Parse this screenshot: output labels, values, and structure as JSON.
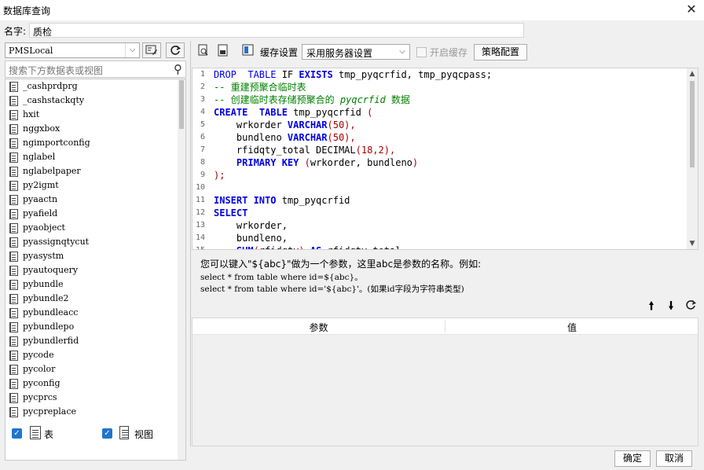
{
  "window": {
    "title": "数据库查询",
    "close_glyph": "✕"
  },
  "name_field": {
    "label": "名字:",
    "value": "质检"
  },
  "left_panel": {
    "datasource": "PMSLocal",
    "search_placeholder": "搜索下方数据表或视图",
    "items": [
      "_cashprdprg",
      "_cashstackqty",
      "hxit",
      "nggxbox",
      "ngimportconfig",
      "nglabel",
      "nglabelpaper",
      "py2igmt",
      "pyaactn",
      "pyafield",
      "pyaobject",
      "pyassignqtycut",
      "pyasystm",
      "pyautoquery",
      "pybundle",
      "pybundle2",
      "pybundleacc",
      "pybundlepo",
      "pybundlerfid",
      "pycode",
      "pycolor",
      "pyconfig",
      "pycprcs",
      "pycpreplace"
    ],
    "filter_table_label": "表",
    "filter_view_label": "视图"
  },
  "toolbar": {
    "cache_label": "缓存设置",
    "cache_option": "采用服务器设置",
    "enable_cache_label": "开启缓存",
    "strategy_button": "策略配置"
  },
  "help": {
    "line1": "您可以键入\"${abc}\"做为一个参数，这里abc是参数的名称。例如:",
    "line2": "select * from table where id=${abc}。",
    "line3": "select * from table where id='${abc}'。(如果id字段为字符串类型)"
  },
  "param_table": {
    "col_param": "参数",
    "col_value": "值"
  },
  "buttons": {
    "ok": "确定",
    "cancel": "取消"
  }
}
